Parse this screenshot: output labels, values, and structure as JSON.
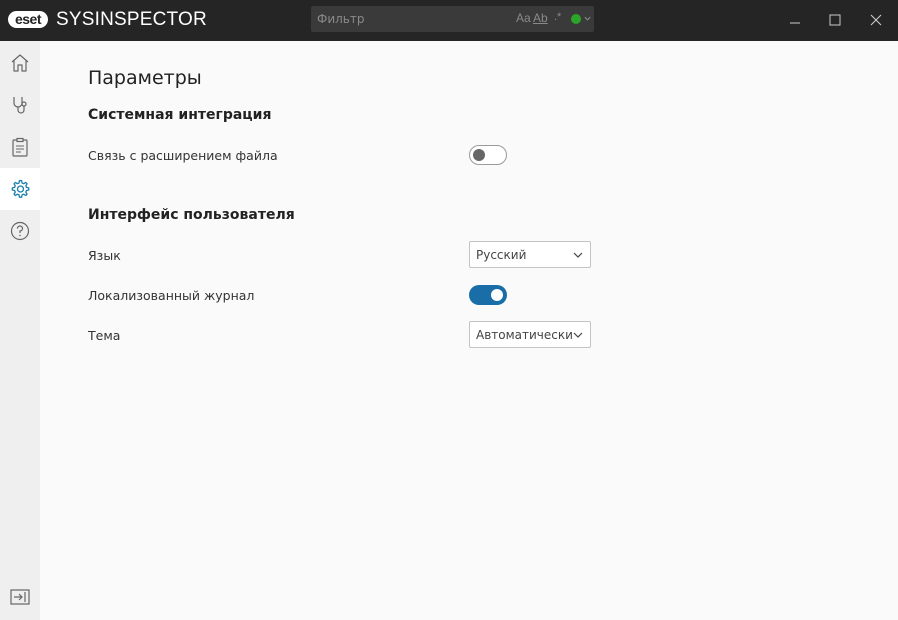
{
  "titlebar": {
    "logo_text": "eset",
    "app_name": "SYSINSPECTOR",
    "filter": {
      "placeholder": "Фильтр",
      "case_option": "Aa",
      "word_option": "Ab",
      "regex_option": ".*",
      "status_color": "#2aa52a"
    }
  },
  "sidebar": {
    "items": [
      {
        "icon": "home-icon",
        "active": false
      },
      {
        "icon": "stethoscope-icon",
        "active": false
      },
      {
        "icon": "clipboard-icon",
        "active": false
      },
      {
        "icon": "gear-icon",
        "active": true
      },
      {
        "icon": "help-icon",
        "active": false
      }
    ],
    "bottom_icon": "collapse-sidebar-icon"
  },
  "main": {
    "title": "Параметры",
    "sections": [
      {
        "title": "Системная интеграция",
        "rows": [
          {
            "label": "Связь с расширением файла",
            "control": "toggle",
            "value": false
          }
        ]
      },
      {
        "title": "Интерфейс пользователя",
        "rows": [
          {
            "label": "Язык",
            "control": "select",
            "value": "Русский"
          },
          {
            "label": "Локализованный журнал",
            "control": "toggle",
            "value": true
          },
          {
            "label": "Тема",
            "control": "select",
            "value": "Автоматически"
          }
        ]
      }
    ]
  },
  "colors": {
    "titlebar": "#252525",
    "accent": "#1a6ea8",
    "active_nav_icon": "#1a7faa"
  }
}
